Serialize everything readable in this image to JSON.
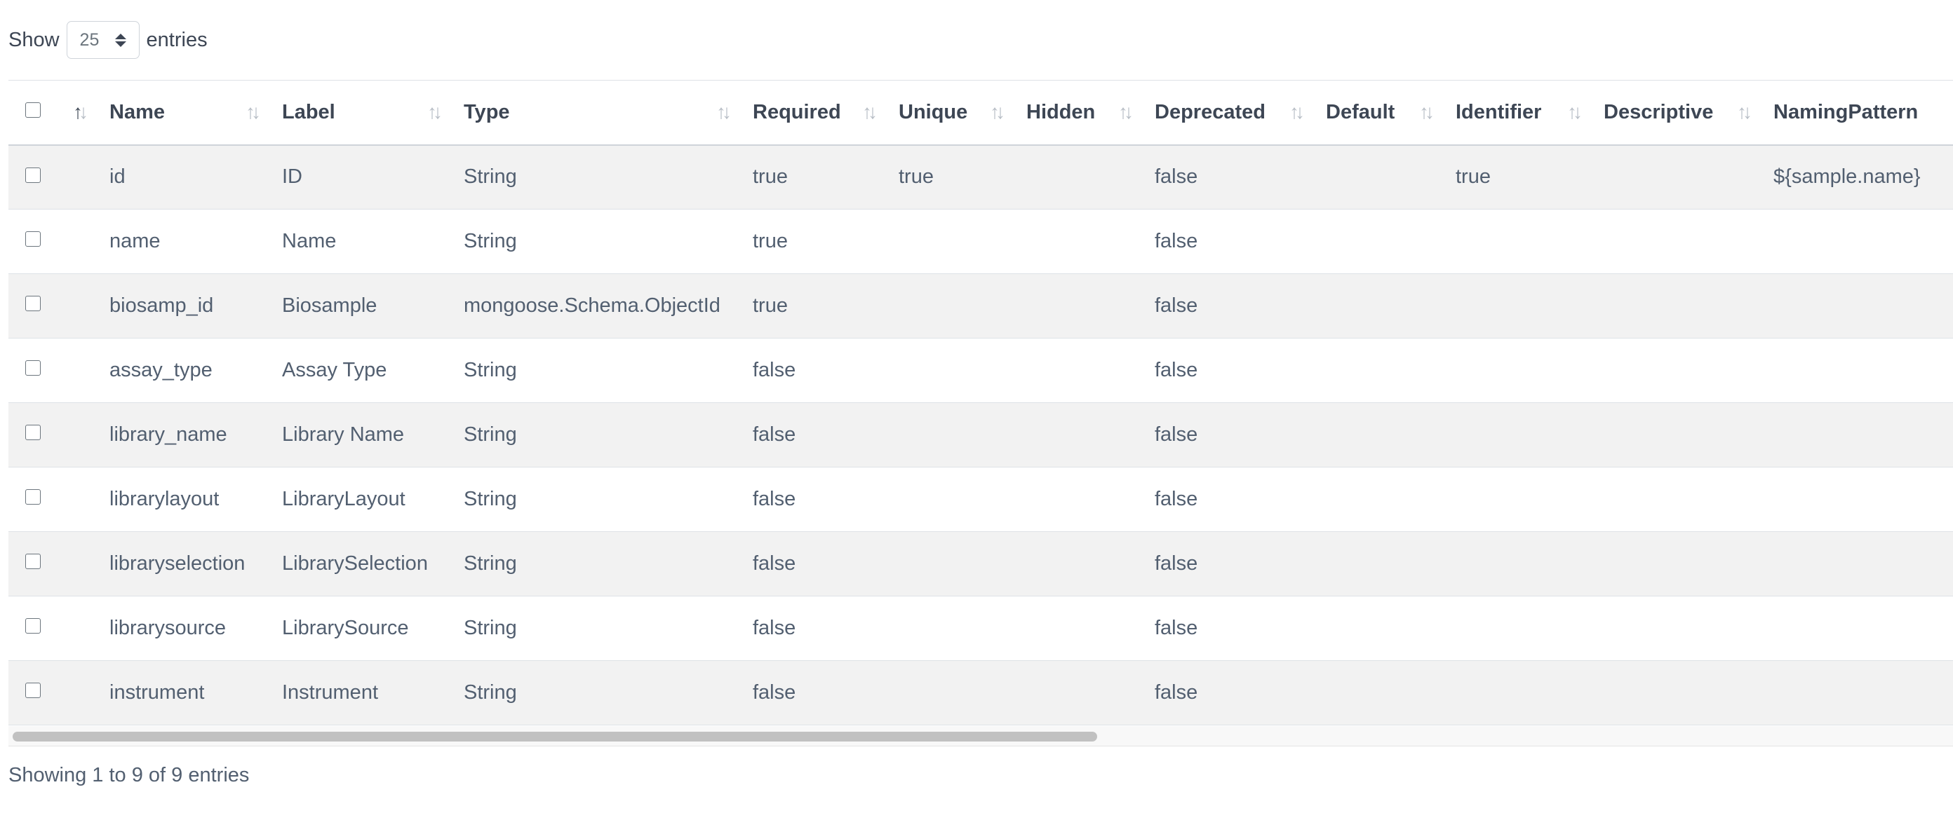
{
  "length_control": {
    "prefix": "Show",
    "value": "25",
    "suffix": "entries"
  },
  "table": {
    "columns": [
      {
        "key": "name",
        "label": "Name"
      },
      {
        "key": "label",
        "label": "Label"
      },
      {
        "key": "type",
        "label": "Type"
      },
      {
        "key": "required",
        "label": "Required"
      },
      {
        "key": "unique",
        "label": "Unique"
      },
      {
        "key": "hidden",
        "label": "Hidden"
      },
      {
        "key": "deprecated",
        "label": "Deprecated"
      },
      {
        "key": "default",
        "label": "Default"
      },
      {
        "key": "identifier",
        "label": "Identifier"
      },
      {
        "key": "descriptive",
        "label": "Descriptive"
      },
      {
        "key": "naming_pattern",
        "label": "NamingPattern"
      }
    ],
    "rows": [
      {
        "name": "id",
        "label": "ID",
        "type": "String",
        "required": "true",
        "unique": "true",
        "hidden": "",
        "deprecated": "false",
        "default": "",
        "identifier": "true",
        "descriptive": "",
        "naming_pattern": "${sample.name}"
      },
      {
        "name": "name",
        "label": "Name",
        "type": "String",
        "required": "true",
        "unique": "",
        "hidden": "",
        "deprecated": "false",
        "default": "",
        "identifier": "",
        "descriptive": "",
        "naming_pattern": ""
      },
      {
        "name": "biosamp_id",
        "label": "Biosample",
        "type": "mongoose.Schema.ObjectId",
        "required": "true",
        "unique": "",
        "hidden": "",
        "deprecated": "false",
        "default": "",
        "identifier": "",
        "descriptive": "",
        "naming_pattern": ""
      },
      {
        "name": "assay_type",
        "label": "Assay Type",
        "type": "String",
        "required": "false",
        "unique": "",
        "hidden": "",
        "deprecated": "false",
        "default": "",
        "identifier": "",
        "descriptive": "",
        "naming_pattern": ""
      },
      {
        "name": "library_name",
        "label": "Library Name",
        "type": "String",
        "required": "false",
        "unique": "",
        "hidden": "",
        "deprecated": "false",
        "default": "",
        "identifier": "",
        "descriptive": "",
        "naming_pattern": ""
      },
      {
        "name": "librarylayout",
        "label": "LibraryLayout",
        "type": "String",
        "required": "false",
        "unique": "",
        "hidden": "",
        "deprecated": "false",
        "default": "",
        "identifier": "",
        "descriptive": "",
        "naming_pattern": ""
      },
      {
        "name": "libraryselection",
        "label": "LibrarySelection",
        "type": "String",
        "required": "false",
        "unique": "",
        "hidden": "",
        "deprecated": "false",
        "default": "",
        "identifier": "",
        "descriptive": "",
        "naming_pattern": ""
      },
      {
        "name": "librarysource",
        "label": "LibrarySource",
        "type": "String",
        "required": "false",
        "unique": "",
        "hidden": "",
        "deprecated": "false",
        "default": "",
        "identifier": "",
        "descriptive": "",
        "naming_pattern": ""
      },
      {
        "name": "instrument",
        "label": "Instrument",
        "type": "String",
        "required": "false",
        "unique": "",
        "hidden": "",
        "deprecated": "false",
        "default": "",
        "identifier": "",
        "descriptive": "",
        "naming_pattern": ""
      }
    ]
  },
  "info": "Showing 1 to 9 of 9 entries",
  "icons": {
    "sort": "sort-updown-icon",
    "select_arrows": "select-updown-icon",
    "checkbox": "checkbox-icon"
  },
  "colors": {
    "stripe": "#f2f2f2",
    "header_text": "#3d4654",
    "body_text": "#525f70",
    "sort_icon": "#b8bec6"
  }
}
